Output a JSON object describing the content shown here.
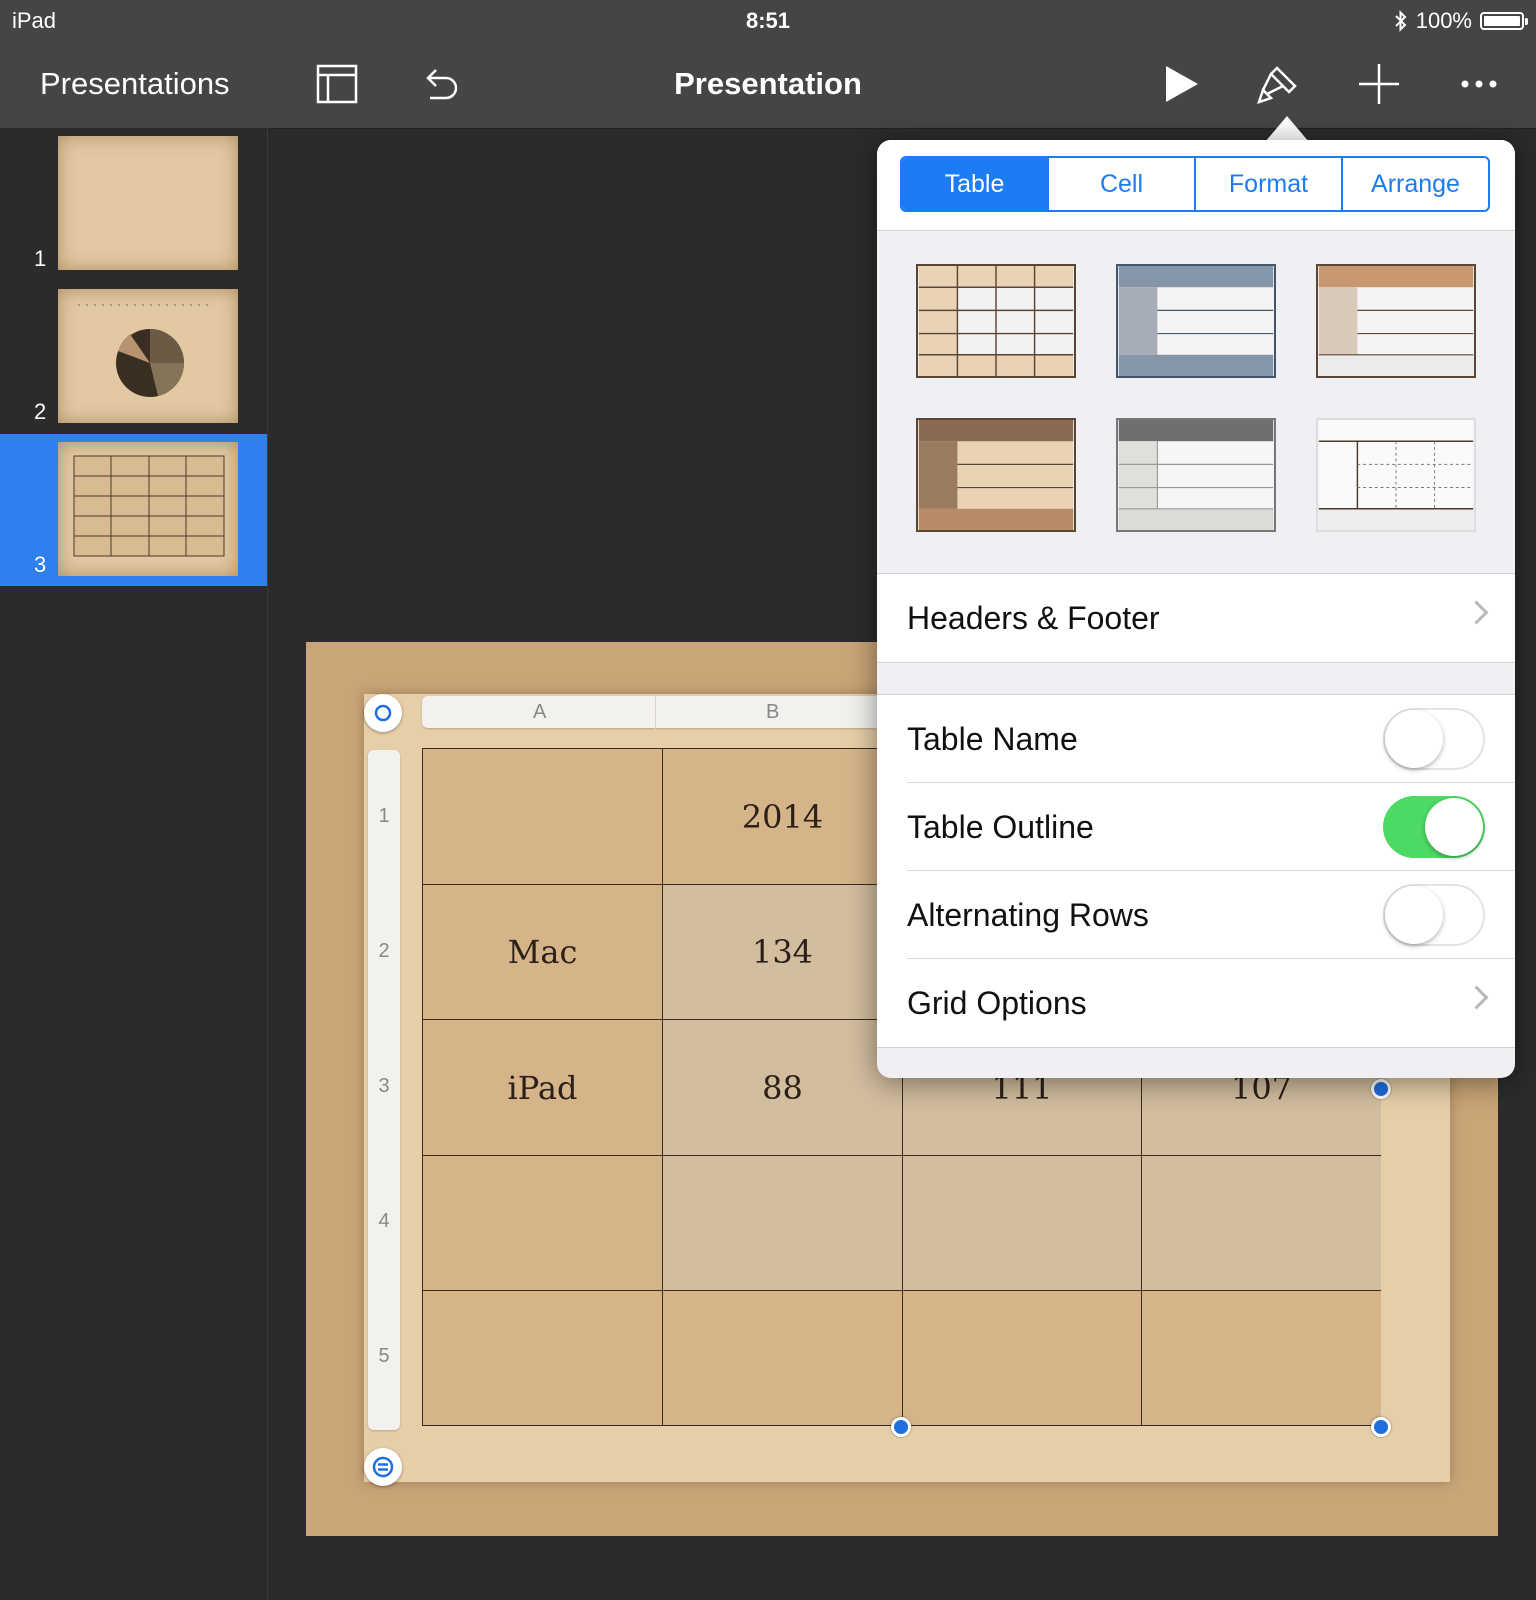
{
  "status": {
    "device": "iPad",
    "time": "8:51",
    "battery": "100%",
    "battery_level": 1.0
  },
  "toolbar": {
    "back_label": "Presentations",
    "title": "Presentation"
  },
  "slides": [
    {
      "number": "1"
    },
    {
      "number": "2"
    },
    {
      "number": "3",
      "selected": true
    }
  ],
  "table": {
    "columns": [
      "A",
      "B"
    ],
    "rows": [
      "1",
      "2",
      "3",
      "4",
      "5"
    ],
    "cells": [
      [
        "",
        "2014",
        "",
        ""
      ],
      [
        "Mac",
        "134",
        "",
        ""
      ],
      [
        "iPad",
        "88",
        "111",
        "107"
      ],
      [
        "",
        "",
        "",
        ""
      ],
      [
        "",
        "",
        "",
        ""
      ]
    ]
  },
  "popover": {
    "tabs": [
      "Table",
      "Cell",
      "Format",
      "Arrange"
    ],
    "active_tab": "Table",
    "headers_footer": "Headers & Footer",
    "table_name": {
      "label": "Table Name",
      "on": false
    },
    "table_outline": {
      "label": "Table Outline",
      "on": true
    },
    "alternating_rows": {
      "label": "Alternating Rows",
      "on": false
    },
    "grid_options": "Grid Options"
  },
  "colors": {
    "accent": "#1c7cf4",
    "toggle_on": "#4cd964",
    "selection": "#2f7ff0"
  }
}
